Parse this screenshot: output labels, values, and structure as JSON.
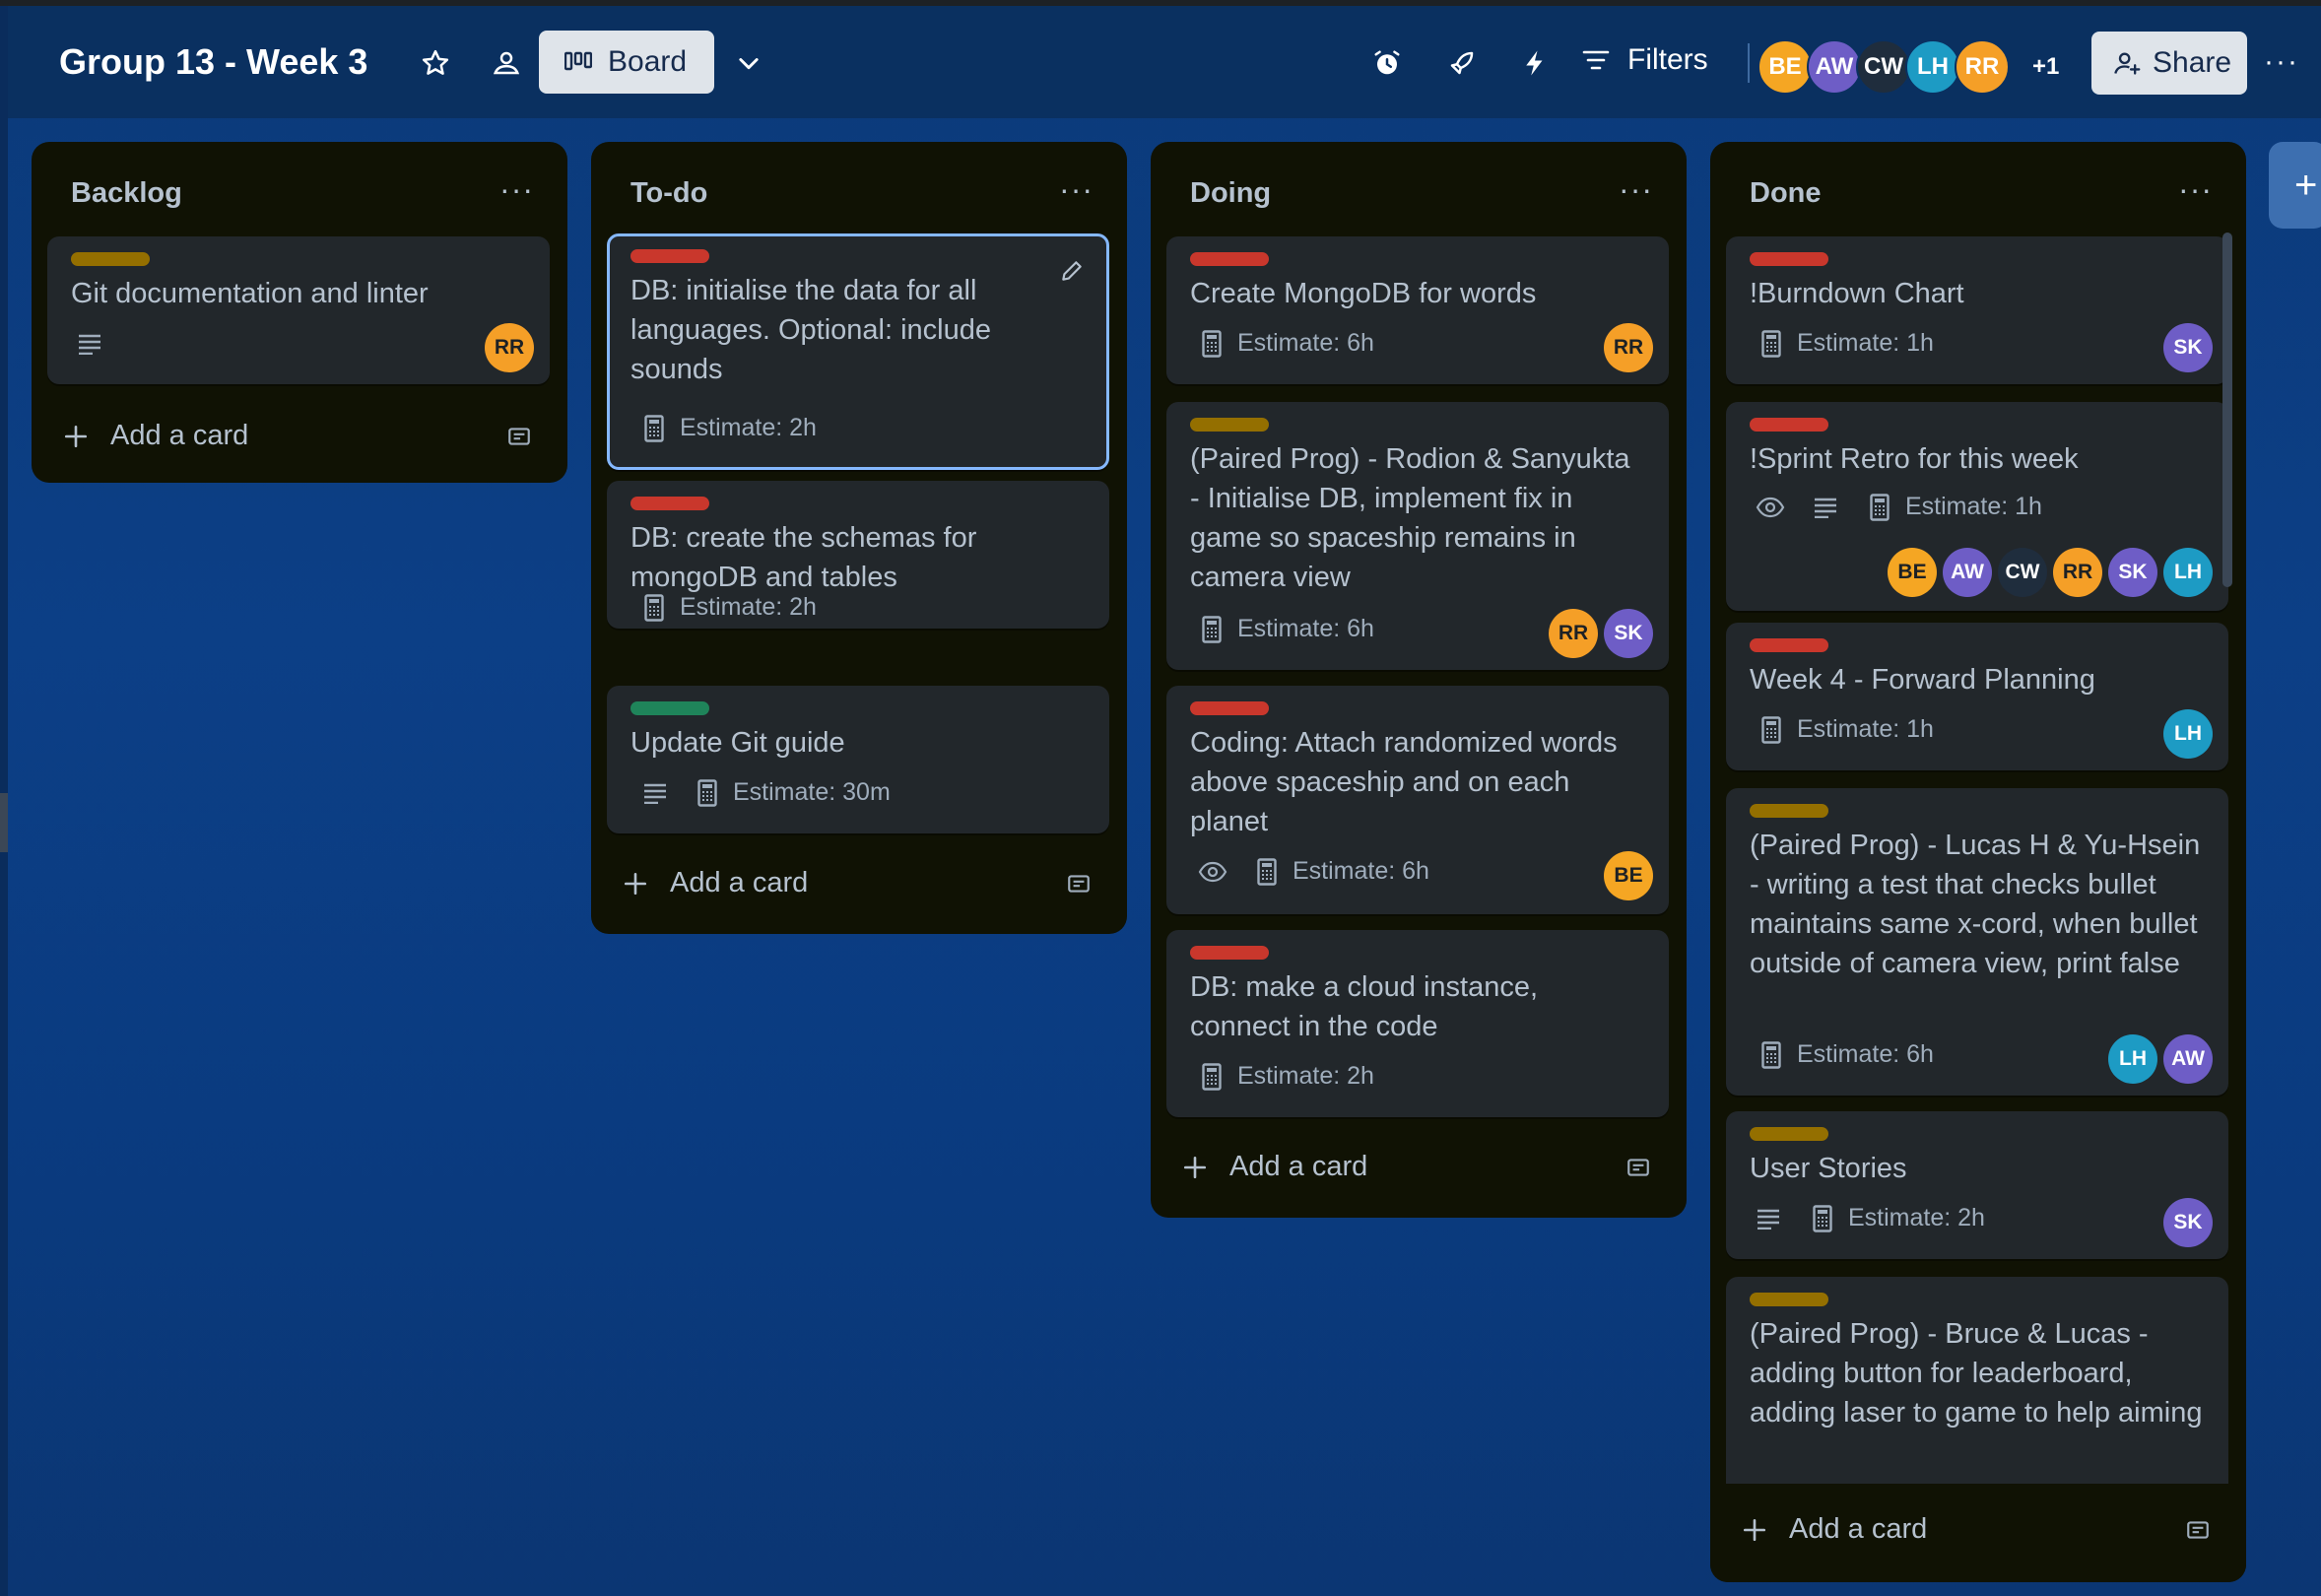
{
  "board": {
    "title": "Group 13 - Week 3",
    "view_label": "Board",
    "filters_label": "Filters",
    "share_label": "Share",
    "more_label": "···",
    "members_more": "+1",
    "members": [
      {
        "initials": "BE",
        "color": "#f5a623"
      },
      {
        "initials": "AW",
        "color": "#6e5dc6"
      },
      {
        "initials": "CW",
        "color": "#1f2d3d"
      },
      {
        "initials": "LH",
        "color": "#1d9bc4"
      },
      {
        "initials": "RR",
        "color": "#f59f27"
      }
    ]
  },
  "lists": [
    {
      "title": "Backlog",
      "add_card": "Add a card",
      "cards": [
        {
          "label_color": "#946f00",
          "title": "Git documentation and linter",
          "members": [
            "RR"
          ],
          "description": true
        }
      ]
    },
    {
      "title": "To-do",
      "add_card": "Add a card",
      "cards": [
        {
          "label_color": "#c9372c",
          "title": "DB: initialise the data for all languages. Optional: include sounds",
          "estimate": "Estimate: 2h",
          "selected": true
        },
        {
          "label_color": "#c9372c",
          "title": "DB: create the schemas for mongoDB and tables",
          "estimate": "Estimate: 2h"
        },
        {
          "label_color": "#1f845a",
          "title": "Update Git guide",
          "estimate": "Estimate: 30m",
          "description": true
        }
      ]
    },
    {
      "title": "Doing",
      "add_card": "Add a card",
      "cards": [
        {
          "label_color": "#c9372c",
          "title": "Create MongoDB for words",
          "estimate": "Estimate: 6h",
          "members": [
            "RR"
          ]
        },
        {
          "label_color": "#946f00",
          "title": "(Paired Prog) - Rodion & Sanyukta - Initialise DB, implement fix in game so spaceship remains in camera view",
          "estimate": "Estimate: 6h",
          "members": [
            "RR",
            "SK"
          ]
        },
        {
          "label_color": "#c9372c",
          "title": "Coding: Attach randomized words above spaceship and on each planet",
          "estimate": "Estimate: 6h",
          "members": [
            "BE"
          ],
          "watching": true
        },
        {
          "label_color": "#c9372c",
          "title": "DB: make a cloud instance, connect in the code",
          "estimate": "Estimate: 2h"
        }
      ]
    },
    {
      "title": "Done",
      "add_card": "Add a card",
      "cards": [
        {
          "label_color": "#c9372c",
          "title": "!Burndown Chart",
          "estimate": "Estimate: 1h",
          "members": [
            "SK"
          ]
        },
        {
          "label_color": "#c9372c",
          "title": "!Sprint Retro for this week",
          "estimate": "Estimate: 1h",
          "members": [
            "BE",
            "AW",
            "CW",
            "RR",
            "SK",
            "LH"
          ],
          "watching": true,
          "description": true
        },
        {
          "label_color": "#c9372c",
          "title": "Week 4 - Forward Planning",
          "estimate": "Estimate: 1h",
          "members": [
            "LH"
          ]
        },
        {
          "label_color": "#946f00",
          "title": "(Paired Prog) - Lucas H & Yu-Hsein - writing a test that checks bullet maintains same x-cord, when bullet outside of camera view, print false",
          "estimate": "Estimate: 6h",
          "members": [
            "LH",
            "AW"
          ]
        },
        {
          "label_color": "#946f00",
          "title": "User Stories",
          "estimate": "Estimate: 2h",
          "members": [
            "SK"
          ],
          "description": true
        },
        {
          "label_color": "#946f00",
          "title": "(Paired Prog) - Bruce & Lucas - adding button for leaderboard, adding laser to game to help aiming"
        }
      ]
    }
  ],
  "member_colors": {
    "RR": "#f59f27",
    "SK": "#6e5dc6",
    "BE": "#f5a623",
    "AW": "#6e5dc6",
    "CW": "#1f2d3d",
    "LH": "#1d9bc4"
  }
}
